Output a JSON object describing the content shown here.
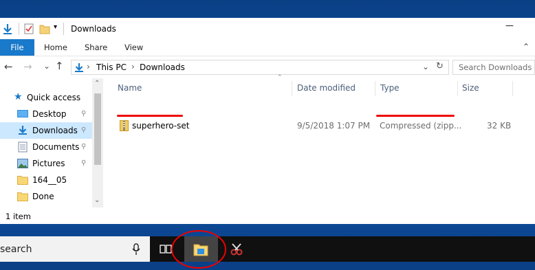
{
  "window": {
    "title": "Downloads",
    "tabs": {
      "file": "File",
      "home": "Home",
      "share": "Share",
      "view": "View"
    },
    "controls": {
      "minimize": "—",
      "expand": "⌃"
    }
  },
  "navbar": {
    "back": "←",
    "forward": "→",
    "dropdown": "⌄",
    "up": "↑",
    "breadcrumb": {
      "root": "This PC",
      "sep1": "›",
      "sep0": "›",
      "folder": "Downloads"
    },
    "addr_dropdown": "⌄",
    "refresh": "↻",
    "search_placeholder": "Search Downloads"
  },
  "sidebar": {
    "quick_access": "Quick access",
    "items": [
      {
        "label": "Desktop",
        "pinned": true
      },
      {
        "label": "Downloads",
        "pinned": true,
        "selected": true
      },
      {
        "label": "Documents",
        "pinned": true
      },
      {
        "label": "Pictures",
        "pinned": true
      },
      {
        "label": "164__05",
        "pinned": false
      },
      {
        "label": "Done",
        "pinned": false
      }
    ],
    "pin_glyph": "📌",
    "scroll_up": "⌃",
    "scroll_down": "⌄"
  },
  "list": {
    "columns": {
      "name": "Name",
      "date": "Date modified",
      "type": "Type",
      "size": "Size"
    },
    "collapse": "⌃",
    "files": [
      {
        "name": "superhero-set",
        "date": "9/5/2018 1:07 PM",
        "type": "Compressed (zipp...",
        "size": "32 KB"
      }
    ]
  },
  "status": {
    "count": "1 item"
  },
  "taskbar": {
    "search_text": "search"
  },
  "colors": {
    "accent": "#1979ca",
    "selected": "#cce8ff",
    "annotation": "#e00000"
  }
}
